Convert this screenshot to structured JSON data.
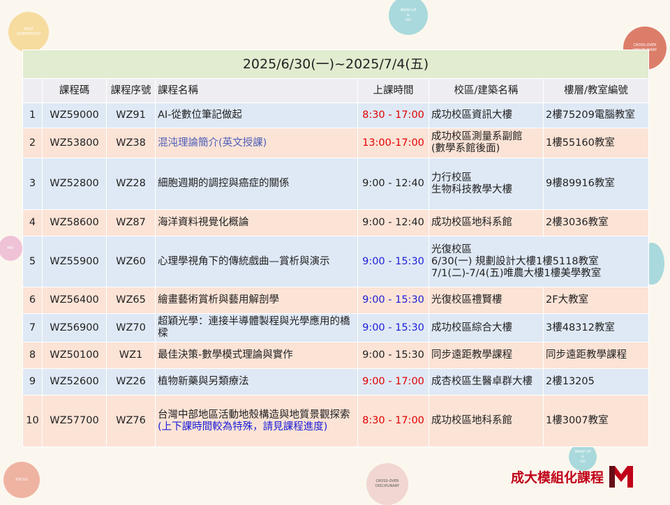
{
  "decor": {
    "bubbles": [
      "ROLE\nORIENTATION",
      "WRAP-UP\n&\nGO",
      "CROSS-OVER\nDISCIPLINARY",
      "MIX",
      "",
      "FOCUS",
      "CROSS-OVER\nDISCIPLINARY",
      "WRAP-UP\n&\nGO"
    ]
  },
  "table": {
    "title": "2025/6/30(一)~2025/7/4(五)",
    "headers": [
      "",
      "課程碼",
      "課程序號",
      "課程名稱",
      "上課時間",
      "校區/建築名稱",
      "樓層/教室編號"
    ],
    "rows": [
      {
        "no": "1",
        "code": "WZ59000",
        "seq": "WZ91",
        "name": "AI-從數位筆記做起",
        "name_note": "",
        "time": "8:30 - 17:00",
        "campus": "成功校區資訊大樓",
        "room": "2樓75209電腦教室"
      },
      {
        "no": "2",
        "code": "WZ53800",
        "seq": "WZ38",
        "name": "混沌理論簡介(英文授課)",
        "name_note": "",
        "time": "13:00-17:00",
        "campus": "成功校區測量系副館\n(數學系館後面)",
        "room": "1樓55160教室"
      },
      {
        "no": "3",
        "code": "WZ52800",
        "seq": "WZ28",
        "name": "細胞週期的調控與癌症的關係",
        "name_note": "",
        "time": "9:00 - 12:40",
        "campus": "力行校區\n生物科技教學大樓",
        "room": "9樓89916教室"
      },
      {
        "no": "4",
        "code": "WZ58600",
        "seq": "WZ87",
        "name": "海洋資料視覺化概論",
        "name_note": "",
        "time": "9:00 - 12:40",
        "campus": "成功校區地科系館",
        "room": "2樓3036教室"
      },
      {
        "no": "5",
        "code": "WZ55900",
        "seq": "WZ60",
        "name": "心理學視角下的傳統戲曲—賞析與演示",
        "name_note": "",
        "time": "9:00 - 15:30",
        "campus": "光復校區\n6/30(一) 規劃設計大樓1樓5118教室\n7/1(二)-7/4(五)唯農大樓1樓美學教室",
        "room": ""
      },
      {
        "no": "6",
        "code": "WZ56400",
        "seq": "WZ65",
        "name": "繪畫藝術賞析與藝用解剖學",
        "name_note": "",
        "time": "9:00 - 15:30",
        "campus": "光復校區禮賢樓",
        "room": "2F大教室"
      },
      {
        "no": "7",
        "code": "WZ56900",
        "seq": "WZ70",
        "name": "超穎光學：連接半導體製程與光學應用的橋樑",
        "name_note": "",
        "time": "9:00 - 15:30",
        "campus": "成功校區綜合大樓",
        "room": "3樓48312教室"
      },
      {
        "no": "8",
        "code": "WZ50100",
        "seq": "WZ1",
        "name": "最佳決策-數學模式理論與實作",
        "name_note": "",
        "time": "9:00 - 15:30",
        "campus": "同步遠距教學課程",
        "room": "同步遠距教學課程"
      },
      {
        "no": "9",
        "code": "WZ52600",
        "seq": "WZ26",
        "name": "植物新藥與另類療法",
        "name_note": "",
        "time": "9:00 - 17:00",
        "campus": "成杏校區生醫卓群大樓",
        "room": "2樓13205"
      },
      {
        "no": "10",
        "code": "WZ57700",
        "seq": "WZ76",
        "name": "台灣中部地區活動地殼構造與地質景觀探索",
        "name_note": "(上下課時間較為特殊，請見課程進度)",
        "time": "8:30 - 17:00",
        "campus": "成功校區地科系館",
        "room": "1樓3007教室"
      }
    ]
  },
  "branding": {
    "name": "成大模組化課程",
    "accent": "#c00018"
  },
  "colors": {
    "red": "#e00000",
    "blue": "#1e1ed8",
    "purple": "#4f5fb8",
    "row_blue": "#dfe9f5",
    "row_peach": "#fbe3d6",
    "title_green": "#e1ecd0"
  }
}
